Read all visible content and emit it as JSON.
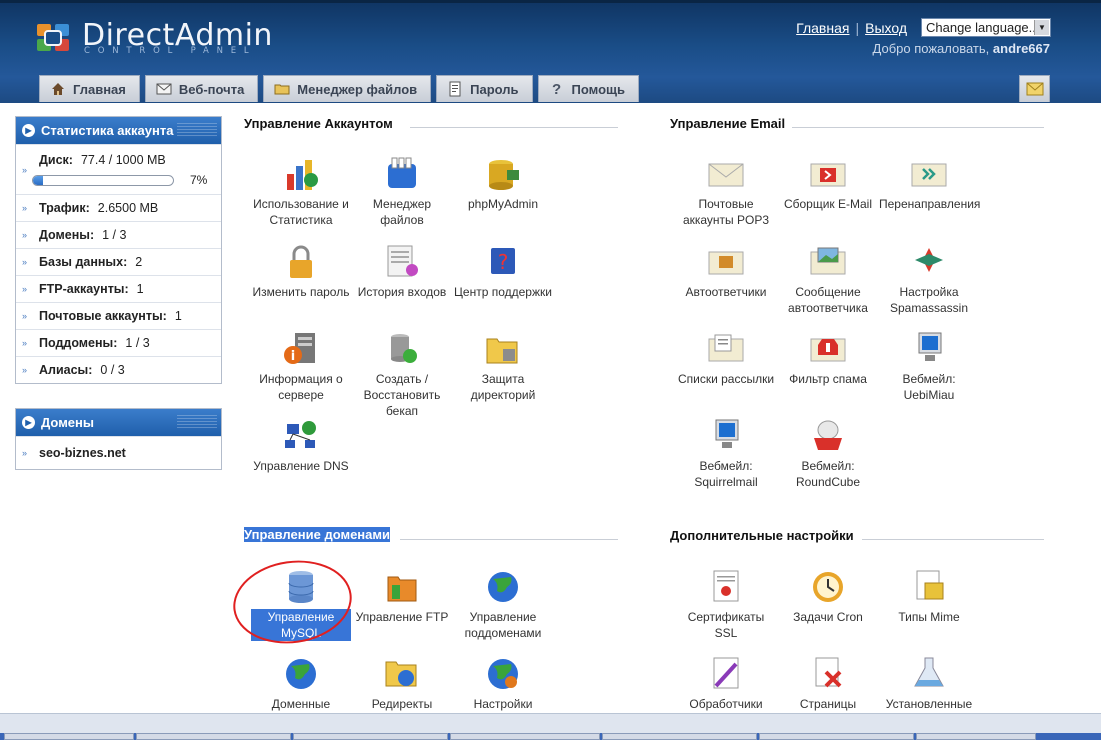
{
  "header": {
    "logo_text": "DirectAdmin",
    "logo_sub": "CONTROL PANEL",
    "links": {
      "home": "Главная",
      "logout": "Выход",
      "separator": "|"
    },
    "language_select": "Change language...",
    "welcome_text": "Добро пожаловать,",
    "username": "andre667"
  },
  "tabs": [
    {
      "label": "Главная",
      "icon": "home-icon"
    },
    {
      "label": "Веб-почта",
      "icon": "envelope-icon"
    },
    {
      "label": "Менеджер файлов",
      "icon": "folder-icon"
    },
    {
      "label": "Пароль",
      "icon": "document-icon"
    },
    {
      "label": "Помощь",
      "icon": "question-icon"
    }
  ],
  "stats": {
    "title": "Статистика аккаунта",
    "disk_label": "Диск:",
    "disk_value": "77.4 / 1000 MB",
    "disk_percent_text": "7%",
    "disk_fraction": 0.074,
    "rows": [
      {
        "label": "Трафик:",
        "value": "2.6500 MB"
      },
      {
        "label": "Домены:",
        "value": "1 / 3"
      },
      {
        "label": "Базы данных:",
        "value": "2"
      },
      {
        "label": "FTP-аккаунты:",
        "value": "1"
      },
      {
        "label": "Почтовые аккаунты:",
        "value": "1"
      },
      {
        "label": "Поддомены:",
        "value": "1 / 3"
      },
      {
        "label": "Алиасы:",
        "value": "0 / 3"
      }
    ]
  },
  "domains": {
    "title": "Домены",
    "items": [
      "seo-biznes.net"
    ]
  },
  "sections": {
    "account": {
      "title": "Управление Аккаунтом",
      "items": [
        {
          "label": "Использование и Статистика",
          "icon": "statistics-icon"
        },
        {
          "label": "Менеджер файлов",
          "icon": "file-manager-icon"
        },
        {
          "label": "phpMyAdmin",
          "icon": "phpmyadmin-icon"
        },
        {
          "label": "Изменить пароль",
          "icon": "padlock-icon"
        },
        {
          "label": "История входов",
          "icon": "login-history-icon"
        },
        {
          "label": "Центр поддержки",
          "icon": "support-icon"
        },
        {
          "label": "Информация о сервере",
          "icon": "server-info-icon"
        },
        {
          "label": "Создать / Восстановить бекап",
          "icon": "backup-icon"
        },
        {
          "label": "Защита директорий",
          "icon": "protected-folder-icon"
        },
        {
          "label": "Управление DNS",
          "icon": "dns-icon"
        }
      ]
    },
    "email": {
      "title": "Управление Email",
      "items": [
        {
          "label": "Почтовые аккаунты POP3",
          "icon": "mail-accounts-icon"
        },
        {
          "label": "Сборщик E-Mail",
          "icon": "catch-all-icon"
        },
        {
          "label": "Перенаправления",
          "icon": "forwarders-icon"
        },
        {
          "label": "Автоответчики",
          "icon": "autoresponder-icon"
        },
        {
          "label": "Сообщение автоответчика",
          "icon": "vacation-message-icon"
        },
        {
          "label": "Настройка Spamassassin",
          "icon": "spamassassin-icon"
        },
        {
          "label": "Списки рассылки",
          "icon": "mailing-list-icon"
        },
        {
          "label": "Фильтр спама",
          "icon": "spam-filter-icon"
        },
        {
          "label": "Вебмейл: UebiMiau",
          "icon": "webmail-uebimiau-icon"
        },
        {
          "label": "Вебмейл: Squirrelmail",
          "icon": "webmail-squirrelmail-icon"
        },
        {
          "label": "Вебмейл: RoundCube",
          "icon": "webmail-roundcube-icon"
        }
      ]
    },
    "domains_mgmt": {
      "title": "Управление доменами",
      "items": [
        {
          "label": "Управление MySQL",
          "icon": "database-icon"
        },
        {
          "label": "Управление FTP",
          "icon": "ftp-icon"
        },
        {
          "label": "Управление поддоменами",
          "icon": "subdomain-globe-icon"
        },
        {
          "label": "Доменные",
          "icon": "domain-globe-icon"
        },
        {
          "label": "Редиректы",
          "icon": "redirect-icon"
        },
        {
          "label": "Настройки",
          "icon": "settings-globe-icon"
        }
      ]
    },
    "advanced": {
      "title": "Дополнительные настройки",
      "items": [
        {
          "label": "Сертификаты SSL",
          "icon": "ssl-certificate-icon"
        },
        {
          "label": "Задачи Cron",
          "icon": "cron-clock-icon"
        },
        {
          "label": "Типы Mime",
          "icon": "mime-types-icon"
        },
        {
          "label": "Обработчики",
          "icon": "handlers-icon"
        },
        {
          "label": "Страницы",
          "icon": "error-pages-icon"
        },
        {
          "label": "Установленные",
          "icon": "installed-perl-icon"
        }
      ]
    }
  }
}
